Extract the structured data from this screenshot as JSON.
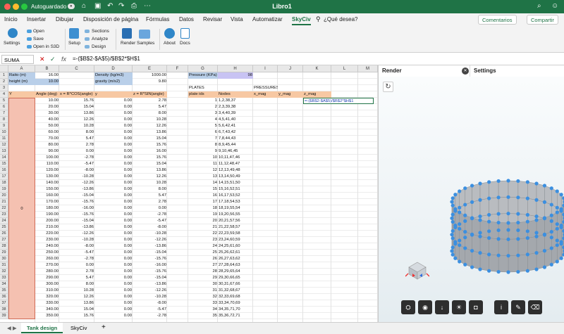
{
  "window": {
    "autosave_label": "Autoguardado",
    "autosave_state": "●",
    "title": "Libro1",
    "icons": [
      "home-icon",
      "save-icon",
      "undo-icon",
      "redo-icon",
      "print-icon",
      "more-icon",
      "search-icon",
      "share-icon"
    ]
  },
  "ribbon_tabs": [
    "Inicio",
    "Insertar",
    "Dibujar",
    "Disposición de página",
    "Fórmulas",
    "Datos",
    "Revisar",
    "Vista",
    "Automatizar",
    "SkyCiv",
    "¿Qué desea?"
  ],
  "ribbon_buttons": {
    "comments": "Comentarios",
    "share": "Compartir"
  },
  "ribbon_items": {
    "settings": "Settings",
    "open": "Open",
    "save": "Save",
    "open_s3d": "Open in S3D",
    "setup": "Setup",
    "sections": "Sections",
    "analyze": "Analyze",
    "design": "Design",
    "render": "Render",
    "samples": "Samples",
    "about": "About",
    "docs": "Docs"
  },
  "formula_bar": {
    "name_box": "SUMA",
    "cancel": "✕",
    "enter": "✓",
    "fx": "fx",
    "formula": "=-($B$2-$A$5)/$B$2*$H$1"
  },
  "columns": [
    "A",
    "B",
    "C",
    "D",
    "E",
    "F",
    "G",
    "H",
    "I",
    "J",
    "K",
    "L",
    "M"
  ],
  "row_numbers": [
    1,
    2,
    3,
    4,
    5,
    6,
    7,
    8,
    9,
    10,
    11,
    12,
    13,
    14,
    15,
    16,
    17,
    18,
    19,
    20,
    21,
    22,
    23,
    24,
    25,
    26,
    27,
    28,
    29,
    30,
    31,
    32,
    33,
    34,
    35,
    36,
    37,
    38,
    39
  ],
  "params": {
    "radius_label": "Raito (m)",
    "radius_value": "16.00",
    "height_label": "height (m)",
    "height_value": "10.00",
    "density_label": "Density (kg/m3)",
    "density_value": "1000.00",
    "gravity_label": "gravity (m/s2)",
    "gravity_value": "9.80",
    "pressure_label": "Pressure (KPa)",
    "pressure_value": "98"
  },
  "headers": {
    "y": "Y",
    "angle": "Angle (deg)",
    "x": "x = R*COS(angle)",
    "yy": "y",
    "z": "z = R*SIN(angle)",
    "plates": "PLATES",
    "plate_ids": "plate ids",
    "nodes": "Nodes",
    "pressures": "PRESSURES",
    "x_mag": "x_mag",
    "y_mag": "y_mag",
    "z_mag": "z_mag",
    "editing_formula": "=-($B$2-$A$5)/$B$2*$H$1"
  },
  "a_merged": "0",
  "angles": [
    "10.00",
    "20.00",
    "30.00",
    "40.00",
    "50.00",
    "60.00",
    "70.00",
    "80.00",
    "90.00",
    "100.00",
    "110.00",
    "120.00",
    "130.00",
    "140.00",
    "150.00",
    "160.00",
    "170.00",
    "180.00",
    "190.00",
    "200.00",
    "210.00",
    "220.00",
    "230.00",
    "240.00",
    "250.00",
    "260.00",
    "270.00",
    "280.00",
    "290.00",
    "300.00",
    "310.00",
    "320.00",
    "330.00",
    "340.00",
    "350.00"
  ],
  "xs": [
    "15.76",
    "15.04",
    "13.86",
    "12.26",
    "10.28",
    "8.00",
    "5.47",
    "2.78",
    "0.00",
    "-2.78",
    "-5.47",
    "-8.00",
    "-10.28",
    "-12.26",
    "-13.86",
    "-15.04",
    "-15.76",
    "-16.00",
    "-15.76",
    "-15.04",
    "-13.86",
    "-12.26",
    "-10.28",
    "-8.00",
    "-5.47",
    "-2.78",
    "0.00",
    "2.78",
    "5.47",
    "8.00",
    "10.28",
    "12.26",
    "13.86",
    "15.04",
    "15.76"
  ],
  "ys": [
    "0.00",
    "0.00",
    "0.00",
    "0.00",
    "0.00",
    "0.00",
    "0.00",
    "0.00",
    "0.00",
    "0.00",
    "0.00",
    "0.00",
    "0.00",
    "0.00",
    "0.00",
    "0.00",
    "0.00",
    "0.00",
    "0.00",
    "0.00",
    "0.00",
    "0.00",
    "0.00",
    "0.00",
    "0.00",
    "0.00",
    "0.00",
    "0.00",
    "0.00",
    "0.00",
    "0.00",
    "0.00",
    "0.00",
    "0.00",
    "0.00"
  ],
  "zs": [
    "2.78",
    "5.47",
    "8.00",
    "10.28",
    "12.26",
    "13.86",
    "15.04",
    "15.76",
    "16.00",
    "15.76",
    "15.04",
    "13.86",
    "12.26",
    "10.28",
    "8.00",
    "5.47",
    "2.78",
    "0.00",
    "-2.78",
    "-5.47",
    "-8.00",
    "-10.28",
    "-12.26",
    "-13.86",
    "-15.04",
    "-15.76",
    "-16.00",
    "-15.76",
    "-15.04",
    "-13.86",
    "-12.26",
    "-10.28",
    "-8.00",
    "-5.47",
    "-2.78"
  ],
  "plate_ids": [
    "1",
    "2",
    "3",
    "4",
    "5",
    "6",
    "7",
    "8",
    "9",
    "10",
    "11",
    "12",
    "13",
    "14",
    "15",
    "16",
    "17",
    "18",
    "19",
    "20",
    "21",
    "22",
    "23",
    "24",
    "25",
    "26",
    "27",
    "28",
    "29",
    "30",
    "31",
    "32",
    "33",
    "34",
    "35"
  ],
  "nodes": [
    "1,2,38,37",
    "2,3,39,38",
    "3,4,40,39",
    "4,5,41,40",
    "5,6,42,41",
    "6,7,43,42",
    "7,8,44,43",
    "8,9,45,44",
    "9,10,46,45",
    "10,11,47,46",
    "11,12,48,47",
    "12,13,49,48",
    "13,14,50,49",
    "14,15,51,50",
    "15,16,52,51",
    "16,17,53,52",
    "17,18,54,53",
    "18,19,55,54",
    "19,20,56,55",
    "20,21,57,56",
    "21,22,58,57",
    "22,23,59,58",
    "23,24,60,59",
    "24,25,61,60",
    "25,26,62,61",
    "26,27,63,62",
    "27,28,64,63",
    "28,29,65,64",
    "29,30,66,65",
    "30,31,67,66",
    "31,32,68,67",
    "32,33,69,68",
    "33,34,70,69",
    "34,35,71,70",
    "35,36,72,71"
  ],
  "panel": {
    "render_tab": "Render",
    "settings_tab": "Settings",
    "close": "✕",
    "refresh": "↻"
  },
  "viewer_toolbar": [
    "layers-icon",
    "eye-icon",
    "download-icon",
    "lightbulb-icon",
    "camera-icon",
    "info-icon",
    "pencil-icon",
    "eraser-icon"
  ],
  "sheet_tabs": {
    "active": "Tank design",
    "other": "SkyCiv",
    "add": "+"
  },
  "colors": {
    "excel_green": "#1f7346",
    "header_blue": "#b9cfe9",
    "header_orange": "#f7c8a3",
    "salmon": "#f5c1b1",
    "pressure_purple": "#c8c3f3",
    "node_blue": "#3b8fe0",
    "plate_gray": "#a4a8ad"
  }
}
